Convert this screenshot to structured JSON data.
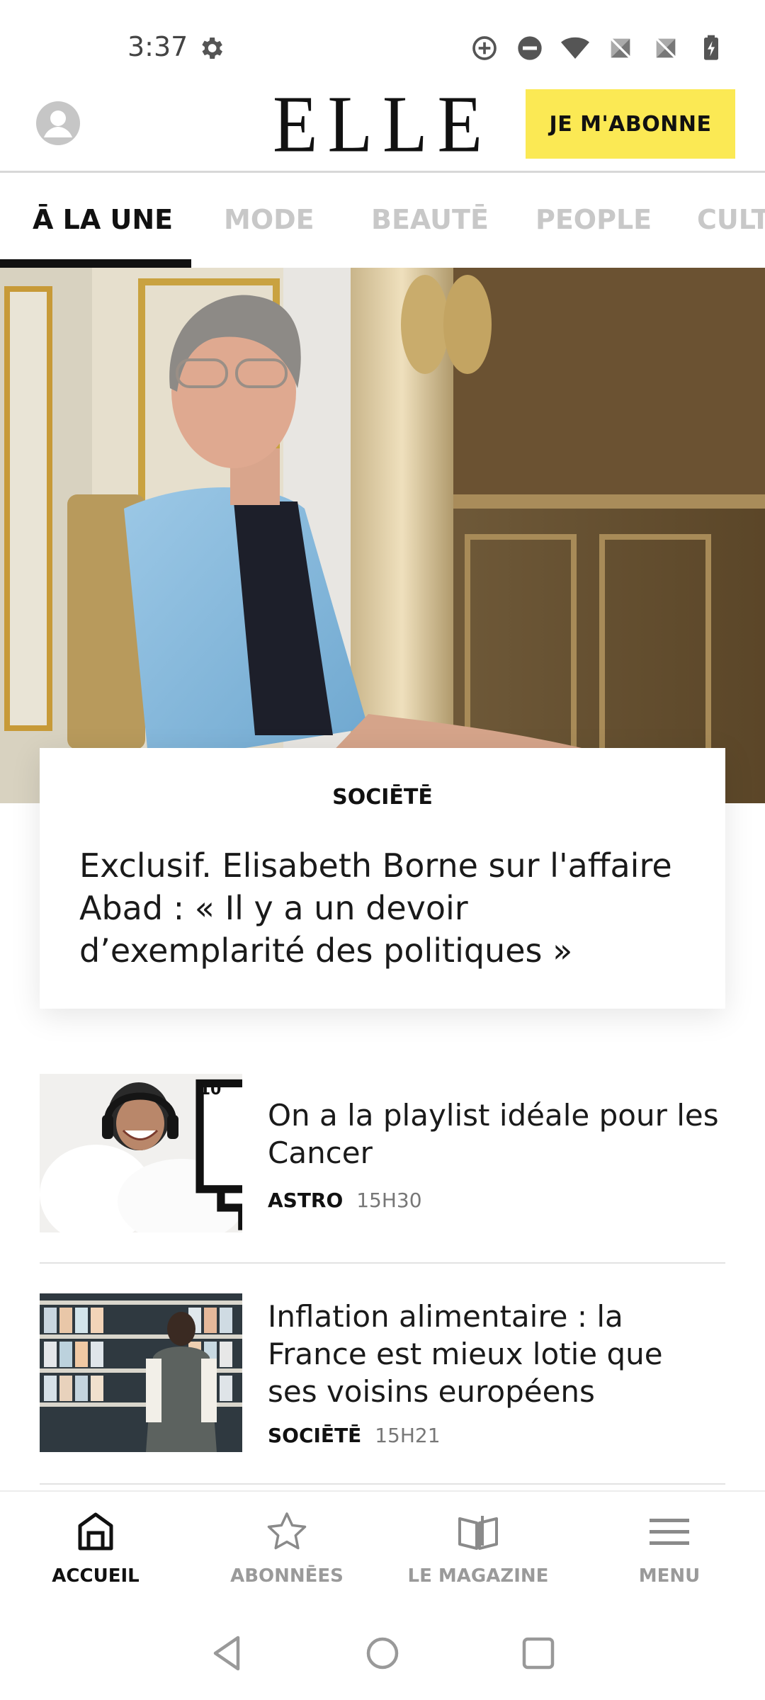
{
  "status_bar": {
    "time": "3:37",
    "icons": [
      "gear-icon",
      "data-saver-icon",
      "do-not-disturb-icon",
      "wifi-icon",
      "no-sim-icon",
      "no-sim-icon",
      "battery-charging-icon"
    ]
  },
  "header": {
    "logo": "ELLE",
    "subscribe_label": "JE M'ABONNE",
    "accent_color": "#fbe954"
  },
  "tabs": [
    {
      "label": "Ā LA UNE",
      "active": true
    },
    {
      "label": "MODE",
      "active": false
    },
    {
      "label": "BEAUTĒ",
      "active": false
    },
    {
      "label": "PEOPLE",
      "active": false
    },
    {
      "label": "CULTU",
      "active": false
    }
  ],
  "hero": {
    "category": "SOCIĒTĒ",
    "title": "Exclusif. Elisabeth Borne sur l'affaire Abad : « Il y a un devoir d’exemplarité des politiques »"
  },
  "articles": [
    {
      "title": "On a la playlist idéale pour les Cancer",
      "category": "ASTRO",
      "time": "15H30",
      "gallery_count": "10"
    },
    {
      "title": "Inflation alimentaire : la France est mieux lotie que ses voisins européens",
      "category": "SOCIĒTĒ",
      "time": "15H21"
    }
  ],
  "bottom_nav": [
    {
      "label": "ACCUEIL",
      "icon": "home-icon",
      "active": true
    },
    {
      "label": "ABONNĒES",
      "icon": "star-icon",
      "active": false
    },
    {
      "label": "LE MAGAZINE",
      "icon": "magazine-icon",
      "active": false
    },
    {
      "label": "MENU",
      "icon": "menu-icon",
      "active": false
    }
  ]
}
